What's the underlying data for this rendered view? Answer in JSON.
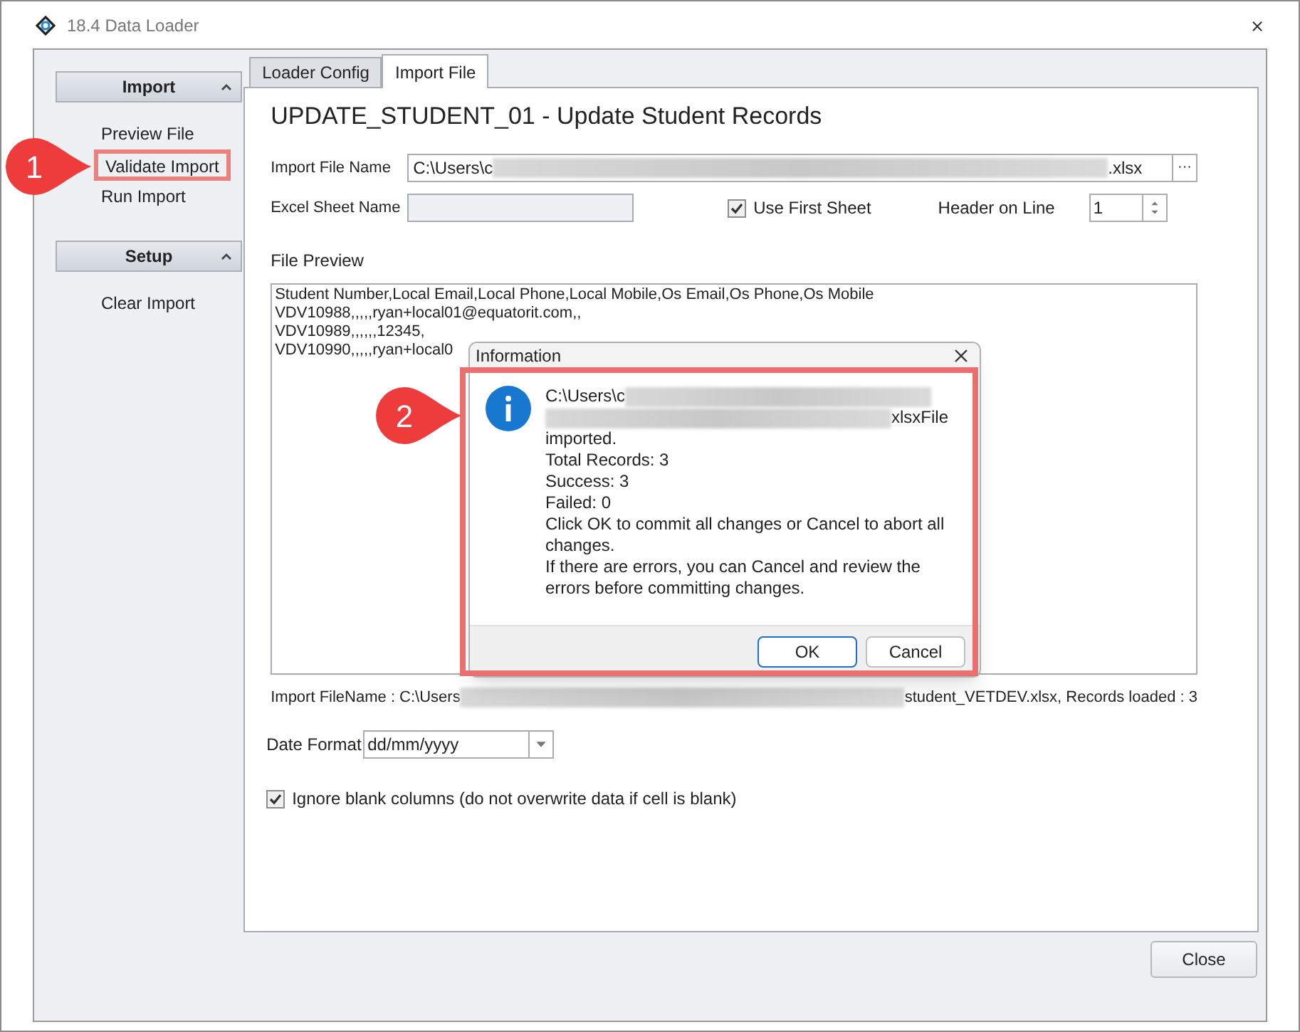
{
  "window": {
    "title": "18.4 Data Loader",
    "close": "⨯"
  },
  "sidebar": {
    "groups": [
      {
        "title": "Import",
        "expanded": true,
        "items": [
          {
            "label": "Preview File",
            "annotated": false
          },
          {
            "label": "Validate Import",
            "annotated": true
          },
          {
            "label": "Run Import",
            "annotated": false
          }
        ]
      },
      {
        "title": "Setup",
        "expanded": true,
        "items": [
          {
            "label": "Clear Import",
            "annotated": false
          }
        ]
      }
    ]
  },
  "tabs": [
    {
      "label": "Loader Config",
      "selected": false
    },
    {
      "label": "Import File",
      "selected": true
    }
  ],
  "form": {
    "heading": "UPDATE_STUDENT_01 - Update Student Records",
    "import_file_name": {
      "label": "Import File Name",
      "value_start": "C:\\Users\\c",
      "value_end": ".xlsx",
      "browse": "···"
    },
    "excel_sheet_name": {
      "label": "Excel Sheet Name"
    },
    "use_first_sheet": {
      "label": "Use First Sheet",
      "checked": true
    },
    "header_on_line": {
      "label": "Header on Line",
      "value": "1"
    },
    "file_preview": {
      "label": "File Preview",
      "lines": [
        "Student Number,Local Email,Local Phone,Local Mobile,Os Email,Os Phone,Os Mobile",
        "VDV10988,,,,,ryan+local01@equatorit.com,,",
        "VDV10989,,,,,,12345,",
        "VDV10990,,,,,ryan+local0"
      ]
    },
    "import_summary": {
      "start": "Import FileName : C:\\Users",
      "end": "student_VETDEV.xlsx, Records loaded : 3"
    },
    "date_format": {
      "label": "Date Format",
      "value": "dd/mm/yyyy"
    },
    "ignore_blank": {
      "label": "Ignore blank columns (do not overwrite data if cell is blank)",
      "checked": true
    }
  },
  "close_button": "Close",
  "dialog": {
    "title": "Information",
    "path_start": "C:\\Users\\c",
    "path_end": "xlsxFile",
    "lines": [
      "imported.",
      "Total Records: 3",
      "Success: 3",
      "Failed: 0",
      "Click OK to commit all changes or Cancel to abort all changes.",
      "If there are errors, you can Cancel and review the errors before committing changes."
    ],
    "buttons": [
      {
        "label": "OK",
        "default": true
      },
      {
        "label": "Cancel",
        "default": false
      }
    ],
    "annotated": true
  },
  "callouts": [
    {
      "label": "1"
    },
    {
      "label": "2"
    }
  ]
}
